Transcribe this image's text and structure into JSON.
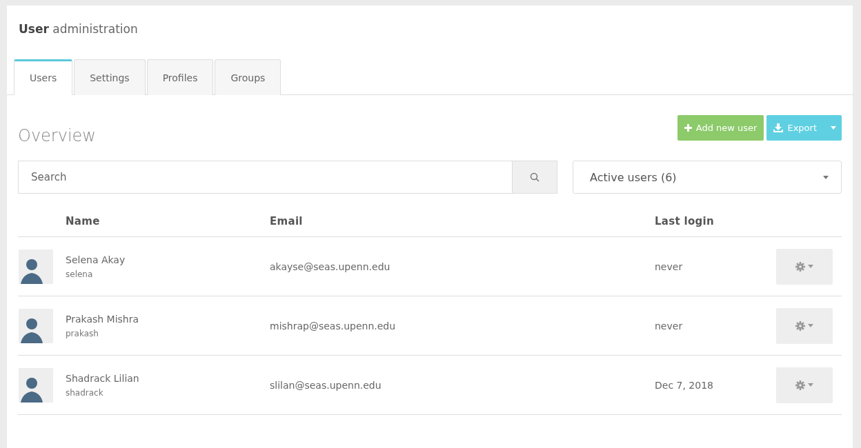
{
  "header": {
    "title": "**User** administration"
  },
  "tabs": [
    {
      "label": "Users",
      "selected": true
    },
    {
      "label": "Settings",
      "selected": false
    },
    {
      "label": "Profiles",
      "selected": false
    },
    {
      "label": "Groups",
      "selected": false
    }
  ],
  "overview": {
    "title": "Overview",
    "add_button": "Add new user",
    "export_button": "Export"
  },
  "search": {
    "placeholder": "Search"
  },
  "filter": {
    "value": "Active users (6)"
  },
  "table": {
    "columns": [
      "Name",
      "Email",
      "Last login"
    ],
    "rows": [
      {
        "name": "Selena Akay",
        "username": "selena",
        "email": "akayse@seas.upenn.edu",
        "last_login": "never"
      },
      {
        "name": "Prakash Mishra",
        "username": "prakash",
        "email": "mishrap@seas.upenn.edu",
        "last_login": "never"
      },
      {
        "name": "Shadrack Lilian",
        "username": "shadrack",
        "email": "slilan@seas.upenn.edu",
        "last_login": "Dec 7, 2018"
      }
    ]
  }
}
